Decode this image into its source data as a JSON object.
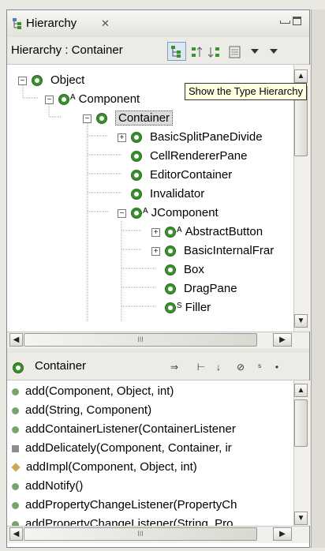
{
  "view": {
    "tab_title": "Hierarchy",
    "tab_close": "✕",
    "hierarchy_label": "Hierarchy : Container"
  },
  "tooltip": "Show the Type Hierarchy",
  "tree": {
    "nodes": [
      {
        "label": "Object",
        "expander": "−",
        "sup": ""
      },
      {
        "label": "Component",
        "expander": "−",
        "sup": "A"
      },
      {
        "label": "Container",
        "expander": "−",
        "sup": ""
      },
      {
        "label": "BasicSplitPaneDivide",
        "expander": "+",
        "sup": ""
      },
      {
        "label": "CellRendererPane",
        "expander": "",
        "sup": ""
      },
      {
        "label": "EditorContainer",
        "expander": "",
        "sup": ""
      },
      {
        "label": "Invalidator",
        "expander": "",
        "sup": ""
      },
      {
        "label": "JComponent",
        "expander": "−",
        "sup": "A"
      },
      {
        "label": "AbstractButton",
        "expander": "+",
        "sup": "A"
      },
      {
        "label": "BasicInternalFrar",
        "expander": "+",
        "sup": ""
      },
      {
        "label": "Box",
        "expander": "",
        "sup": ""
      },
      {
        "label": "DragPane",
        "expander": "",
        "sup": ""
      },
      {
        "label": "Filler",
        "expander": "",
        "sup": "S"
      }
    ]
  },
  "members_header": {
    "title": "Container"
  },
  "members": [
    {
      "label": "add(Component, Object, int)",
      "kind": "public"
    },
    {
      "label": "add(String, Component)",
      "kind": "public"
    },
    {
      "label": "addContainerListener(ContainerListener",
      "kind": "sync"
    },
    {
      "label": "addDelicately(Component, Container, ir",
      "kind": "private"
    },
    {
      "label": "addImpl(Component, Object, int)",
      "kind": "protected"
    },
    {
      "label": "addNotify()",
      "kind": "override"
    },
    {
      "label": "addPropertyChangeListener(PropertyCh",
      "kind": "override"
    },
    {
      "label": "addPropertyChangeListener(String, Pro",
      "kind": "override"
    }
  ],
  "scrollbars": {
    "up_glyph": "▲",
    "down_glyph": "▼",
    "left_glyph": "◀",
    "right_glyph": "▶",
    "grip": "III"
  },
  "colors": {
    "class_icon": "#3a8f2e",
    "selection": "#dcdcdc",
    "tooltip_bg": "#ffffe1"
  }
}
